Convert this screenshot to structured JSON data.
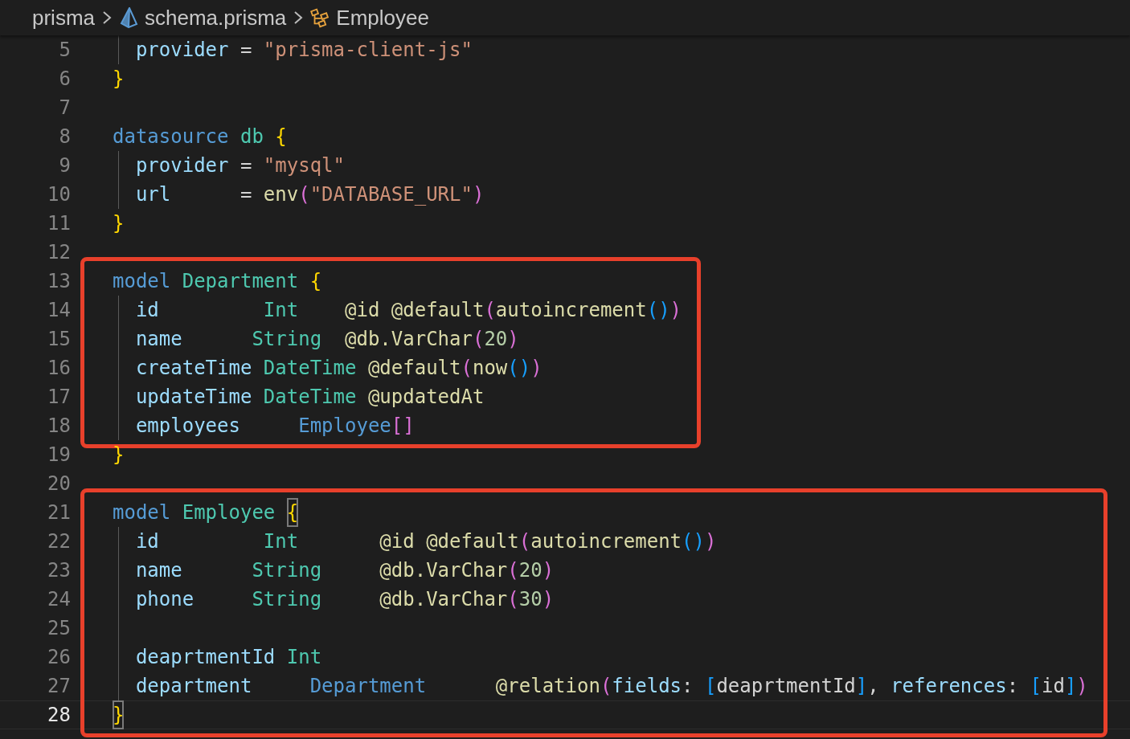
{
  "breadcrumb": [
    {
      "label": "prisma",
      "kind": "folder"
    },
    {
      "label": "schema.prisma",
      "kind": "file"
    },
    {
      "label": "Employee",
      "kind": "symbol"
    }
  ],
  "blocks": [
    {
      "boxed": false,
      "lines": [
        {
          "number": "5",
          "indented": true,
          "current": false,
          "tokens": [
            {
              "text": "provider",
              "kind": "field"
            },
            {
              "text": " = ",
              "kind": "punct"
            },
            {
              "text": "\"prisma-client-js\"",
              "kind": "str"
            }
          ]
        },
        {
          "number": "6",
          "indented": false,
          "current": false,
          "tokens": [
            {
              "text": "}",
              "kind": "brace"
            }
          ]
        },
        {
          "number": "7",
          "indented": false,
          "current": false
        },
        {
          "number": "8",
          "indented": false,
          "current": false,
          "tokens": [
            {
              "text": "datasource",
              "kind": "kw"
            },
            {
              "text": " db ",
              "kind": "type"
            },
            {
              "text": "{",
              "kind": "brace"
            }
          ]
        },
        {
          "number": "9",
          "indented": true,
          "current": false,
          "tokens": [
            {
              "text": "provider",
              "kind": "field"
            },
            {
              "text": " = ",
              "kind": "punct"
            },
            {
              "text": "\"mysql\"",
              "kind": "str"
            }
          ]
        },
        {
          "number": "10",
          "indented": true,
          "current": false,
          "tokens": [
            {
              "text": "url",
              "kind": "field"
            },
            {
              "text": "      = ",
              "kind": "punct"
            },
            {
              "text": "env",
              "kind": "fn"
            },
            {
              "text": "(",
              "kind": "paren1"
            },
            {
              "text": "\"DATABASE_URL\"",
              "kind": "str"
            },
            {
              "text": ")",
              "kind": "paren1"
            }
          ]
        },
        {
          "number": "11",
          "indented": false,
          "current": false,
          "tokens": [
            {
              "text": "}",
              "kind": "brace"
            }
          ]
        },
        {
          "number": "12",
          "indented": false,
          "current": false
        }
      ]
    },
    {
      "boxed": true,
      "lines": [
        {
          "number": "13",
          "indented": false,
          "current": false,
          "tokens": [
            {
              "text": "model",
              "kind": "kw"
            },
            {
              "text": " Department ",
              "kind": "type"
            },
            {
              "text": "{",
              "kind": "brace"
            }
          ]
        },
        {
          "number": "14",
          "indented": true,
          "current": false,
          "tokens": [
            {
              "text": "id         ",
              "kind": "field"
            },
            {
              "text": "Int    ",
              "kind": "type"
            },
            {
              "text": "@id @default",
              "kind": "fn"
            },
            {
              "text": "(",
              "kind": "paren1"
            },
            {
              "text": "autoincrement",
              "kind": "fn"
            },
            {
              "text": "()",
              "kind": "paren2"
            },
            {
              "text": ")",
              "kind": "paren1"
            }
          ]
        },
        {
          "number": "15",
          "indented": true,
          "current": false,
          "tokens": [
            {
              "text": "name      ",
              "kind": "field"
            },
            {
              "text": "String  ",
              "kind": "type"
            },
            {
              "text": "@db.VarChar",
              "kind": "fn"
            },
            {
              "text": "(",
              "kind": "paren1"
            },
            {
              "text": "20",
              "kind": "num"
            },
            {
              "text": ")",
              "kind": "paren1"
            }
          ]
        },
        {
          "number": "16",
          "indented": true,
          "current": false,
          "tokens": [
            {
              "text": "createTime ",
              "kind": "field"
            },
            {
              "text": "DateTime ",
              "kind": "type"
            },
            {
              "text": "@default",
              "kind": "fn"
            },
            {
              "text": "(",
              "kind": "paren1"
            },
            {
              "text": "now",
              "kind": "fn"
            },
            {
              "text": "()",
              "kind": "paren2"
            },
            {
              "text": ")",
              "kind": "paren1"
            }
          ]
        },
        {
          "number": "17",
          "indented": true,
          "current": false,
          "tokens": [
            {
              "text": "updateTime ",
              "kind": "field"
            },
            {
              "text": "DateTime ",
              "kind": "type"
            },
            {
              "text": "@updatedAt",
              "kind": "fn"
            }
          ]
        },
        {
          "number": "18",
          "indented": true,
          "current": false,
          "tokens": [
            {
              "text": "employees     ",
              "kind": "field"
            },
            {
              "text": "Employee",
              "kind": "kw"
            },
            {
              "text": "[]",
              "kind": "paren1"
            }
          ]
        }
      ]
    },
    {
      "boxed": false,
      "lines": [
        {
          "number": "19",
          "indented": false,
          "current": false,
          "tokens": [
            {
              "text": "}",
              "kind": "brace"
            }
          ]
        },
        {
          "number": "20",
          "indented": false,
          "current": false
        }
      ]
    },
    {
      "boxed": true,
      "lines": [
        {
          "number": "21",
          "indented": false,
          "current": false,
          "tokens": [
            {
              "text": "model",
              "kind": "kw"
            },
            {
              "text": " Employee ",
              "kind": "type"
            },
            {
              "text": "{",
              "kind": "brace-match"
            }
          ]
        },
        {
          "number": "22",
          "indented": true,
          "current": false,
          "tokens": [
            {
              "text": "id         ",
              "kind": "field"
            },
            {
              "text": "Int       ",
              "kind": "type"
            },
            {
              "text": "@id @default",
              "kind": "fn"
            },
            {
              "text": "(",
              "kind": "paren1"
            },
            {
              "text": "autoincrement",
              "kind": "fn"
            },
            {
              "text": "()",
              "kind": "paren2"
            },
            {
              "text": ")",
              "kind": "paren1"
            }
          ]
        },
        {
          "number": "23",
          "indented": true,
          "current": false,
          "tokens": [
            {
              "text": "name      ",
              "kind": "field"
            },
            {
              "text": "String     ",
              "kind": "type"
            },
            {
              "text": "@db.VarChar",
              "kind": "fn"
            },
            {
              "text": "(",
              "kind": "paren1"
            },
            {
              "text": "20",
              "kind": "num"
            },
            {
              "text": ")",
              "kind": "paren1"
            }
          ]
        },
        {
          "number": "24",
          "indented": true,
          "current": false,
          "tokens": [
            {
              "text": "phone     ",
              "kind": "field"
            },
            {
              "text": "String     ",
              "kind": "type"
            },
            {
              "text": "@db.VarChar",
              "kind": "fn"
            },
            {
              "text": "(",
              "kind": "paren1"
            },
            {
              "text": "30",
              "kind": "num"
            },
            {
              "text": ")",
              "kind": "paren1"
            }
          ]
        },
        {
          "number": "25",
          "indented": true,
          "current": false
        },
        {
          "number": "26",
          "indented": true,
          "current": false,
          "tokens": [
            {
              "text": "deaprtmentId ",
              "kind": "field"
            },
            {
              "text": "Int",
              "kind": "type"
            }
          ]
        },
        {
          "number": "27",
          "indented": true,
          "current": false,
          "tokens": [
            {
              "text": "department     ",
              "kind": "field"
            },
            {
              "text": "Department      ",
              "kind": "kw"
            },
            {
              "text": "@relation",
              "kind": "fn"
            },
            {
              "text": "(",
              "kind": "paren1"
            },
            {
              "text": "fields",
              "kind": "field"
            },
            {
              "text": ": ",
              "kind": "punct"
            },
            {
              "text": "[",
              "kind": "paren2"
            },
            {
              "text": "deaprtmentId",
              "kind": "punct"
            },
            {
              "text": "]",
              "kind": "paren2"
            },
            {
              "text": ", ",
              "kind": "punct"
            },
            {
              "text": "references",
              "kind": "field"
            },
            {
              "text": ": ",
              "kind": "punct"
            },
            {
              "text": "[",
              "kind": "paren2"
            },
            {
              "text": "id",
              "kind": "punct"
            },
            {
              "text": "]",
              "kind": "paren2"
            },
            {
              "text": ")",
              "kind": "paren1"
            }
          ]
        },
        {
          "number": "28",
          "indented": false,
          "current": true,
          "tokens": [
            {
              "text": "}",
              "kind": "brace-match"
            }
          ]
        }
      ]
    }
  ]
}
